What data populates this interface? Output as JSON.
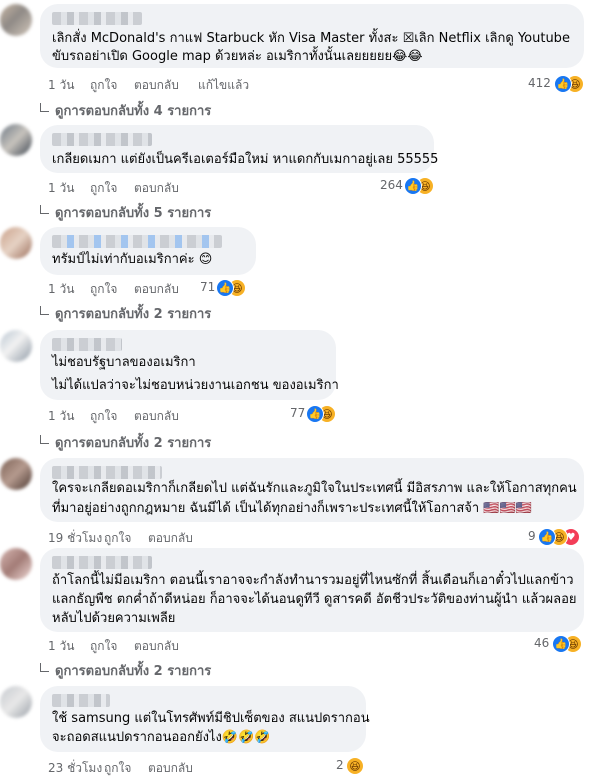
{
  "comments": [
    {
      "lines": [
        "เลิกสั่ง McDonald's กาแฟ Starbuck หัก Visa Master ทั้งสะ ☒เลิก Netflix เลิกดู Youtube",
        "ขับรถอย่าเปิด Google map ด้วยหล่ะ อเมริกาทั้งนั้นเลยยยยย😂😂"
      ],
      "time": "1 วัน",
      "like": "ถูกใจ",
      "reply": "ตอบกลับ",
      "edited": "แก้ไขแล้ว",
      "reaction_count": "412",
      "replies_label": "ดูการตอบกลับทั้ง 4 รายการ"
    },
    {
      "lines": [
        "เกลียดเมกา แต่ยังเป็นครีเอเตอร์มือใหม่ หาแดกกับเมกาอยู่เลย 55555"
      ],
      "time": "1 วัน",
      "like": "ถูกใจ",
      "reply": "ตอบกลับ",
      "reaction_count": "264",
      "replies_label": "ดูการตอบกลับทั้ง 5 รายการ"
    },
    {
      "lines": [
        "ทรัมป์ไม่เท่ากับอเมริกาค่ะ 😊"
      ],
      "time": "1 วัน",
      "like": "ถูกใจ",
      "reply": "ตอบกลับ",
      "reaction_count": "71",
      "replies_label": "ดูการตอบกลับทั้ง 2 รายการ"
    },
    {
      "lines": [
        "ไม่ชอบรัฐบาลของอเมริกา",
        "ไม่ได้แปลว่าจะไม่ชอบหน่วยงานเอกชน ของอเมริกา"
      ],
      "time": "1 วัน",
      "like": "ถูกใจ",
      "reply": "ตอบกลับ",
      "reaction_count": "77",
      "replies_label": "ดูการตอบกลับทั้ง 2 รายการ"
    },
    {
      "lines": [
        "ใครจะเกลียดอเมริกาก็เกลียดไป แต่ฉันรักและภูมิใจในประเทศนี้ มีอิสรภาพ และให้โอกาสทุกคน",
        "ที่มาอยู่อย่างถูกกฎหมาย ฉันมีได้ เป็นได้ทุกอย่างก็เพราะประเทศนี้ให้โอกาสจ้า 🇺🇸🇺🇸🇺🇸"
      ],
      "time": "19 ชั่วโมง",
      "like": "ถูกใจ",
      "reply": "ตอบกลับ",
      "reaction_count": "9",
      "replies_label": ""
    },
    {
      "lines": [
        "ถ้าโลกนี้ไม่มีอเมริกา ตอนนี้เราอาจจะกำลังทำนารวมอยู่ที่ไหนซักที่ สิ้นเดือนก็เอาตั๋วไปแลกข้าว",
        "แลกธัญพืช ตกค่ำถ้าดีหน่อย ก็อาจจะได้นอนดูทีวี ดูสารคดี อัตชีวประวัติของท่านผู้นำ แล้วผลอย",
        "หลับไปด้วยความเพลีย"
      ],
      "time": "1 วัน",
      "like": "ถูกใจ",
      "reply": "ตอบกลับ",
      "reaction_count": "46",
      "replies_label": "ดูการตอบกลับทั้ง 2 รายการ"
    },
    {
      "lines": [
        "ใช้ samsung แต่ในโทรศัพท์มีชิปเซ็ตของ สแนปดรากอน",
        "จะถอดสแนปดรากอนออกยังไง🤣🤣🤣"
      ],
      "time": "23 ชั่วโมง",
      "like": "ถูกใจ",
      "reply": "ตอบกลับ",
      "reaction_count": "2",
      "replies_label": ""
    }
  ],
  "icons": {
    "like": "like-thumb-icon",
    "haha": "haha-face-icon",
    "love": "heart-icon",
    "colors": {
      "like": "#1877f2",
      "haha": "#f7b125",
      "love": "#f33e58",
      "bubble": "#f0f2f5",
      "meta": "#65676b"
    }
  }
}
